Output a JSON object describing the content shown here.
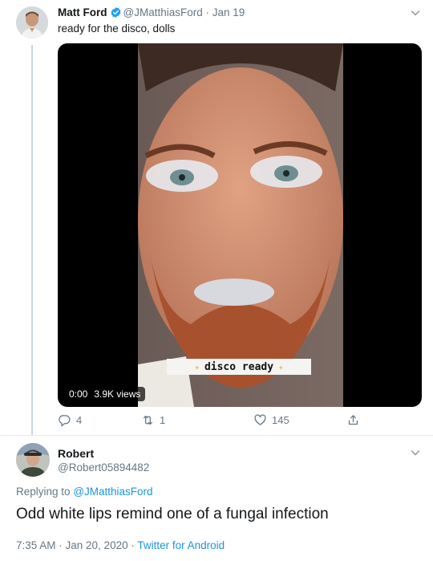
{
  "tweet": {
    "author_name": "Matt Ford",
    "handle": "@JMatthiasFord",
    "separator": "·",
    "date": "Jan 19",
    "text": "ready for the disco, dolls",
    "media": {
      "caption": "disco ready",
      "timestamp": "0:00",
      "views": "3.9K views"
    },
    "actions": {
      "replies": "4",
      "retweets": "1",
      "likes": "145"
    }
  },
  "reply": {
    "author_name": "Robert",
    "handle": "@Robert05894482",
    "replying_prefix": "Replying to",
    "replying_to": "@JMatthiasFord",
    "text": "Odd white lips remind one of a fungal infection",
    "time": "7:35 AM · Jan 20, 2020",
    "separator": "·",
    "source": "Twitter for Android"
  },
  "colors": {
    "verified_blue": "#1da1f2",
    "link_blue": "#1b95e0",
    "muted_gray": "#657786"
  },
  "icons": [
    "verified-badge-icon",
    "chevron-down-icon",
    "reply-icon",
    "retweet-icon",
    "like-icon",
    "share-icon"
  ]
}
